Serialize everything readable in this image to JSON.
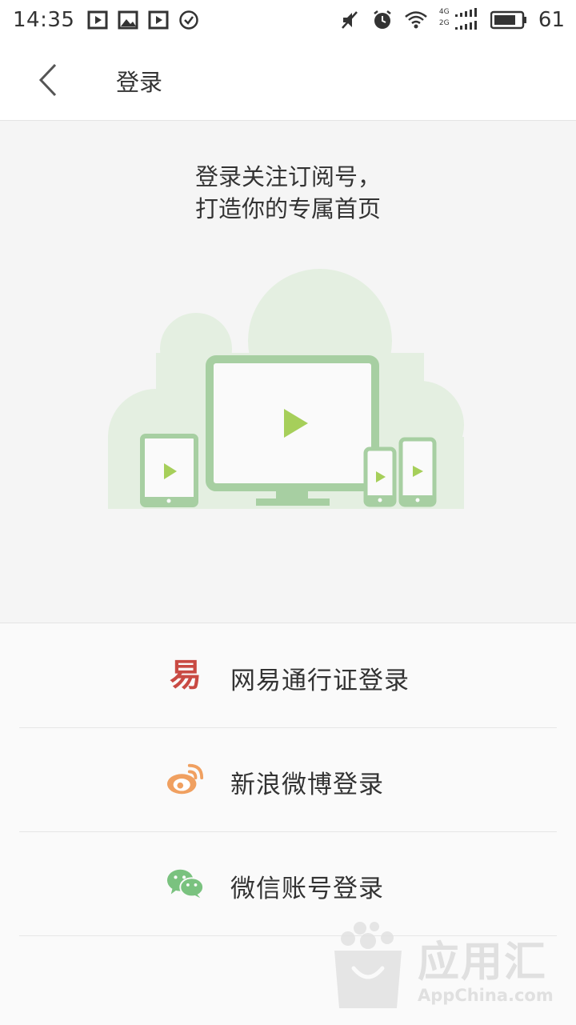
{
  "status_bar": {
    "time": "14:35",
    "battery": "61",
    "network_top": "4G",
    "network_bottom": "2G"
  },
  "nav": {
    "title": "登录"
  },
  "hero": {
    "line1": "登录关注订阅号，",
    "line2": "打造你的专属首页"
  },
  "login_options": [
    {
      "label": "网易通行证登录",
      "icon": "netease-icon",
      "color": "#c94a43"
    },
    {
      "label": "新浪微博登录",
      "icon": "weibo-icon",
      "color": "#f0a060"
    },
    {
      "label": "微信账号登录",
      "icon": "wechat-icon",
      "color": "#7ac27f"
    }
  ],
  "watermark": {
    "brand": "应用汇",
    "site": "AppChina.com"
  },
  "colors": {
    "device_green": "#a7cfa2",
    "cloud_green": "#e4efe1",
    "play_green": "#a6cf5a"
  }
}
